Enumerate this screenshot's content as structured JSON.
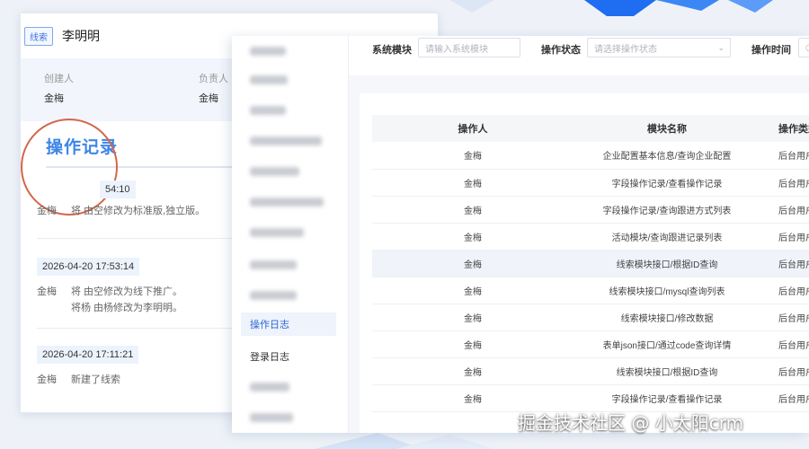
{
  "lead": {
    "tag": "线索",
    "name": "李明明",
    "info": [
      {
        "label": "创建人",
        "value": "金梅"
      },
      {
        "label": "负责人",
        "value": "金梅"
      }
    ]
  },
  "operation_record": {
    "title": "操作记录",
    "entries": [
      {
        "time": "54:10",
        "lines": [
          {
            "who": "金梅",
            "text": "将 由空修改为标准版,独立版。"
          }
        ]
      },
      {
        "time": "2026-04-20 17:53:14",
        "lines": [
          {
            "who": "金梅",
            "text": "将 由空修改为线下推广。"
          },
          {
            "who": "",
            "text": "将杨 由杨修改为李明明。"
          }
        ]
      },
      {
        "time": "2026-04-20 17:11:21",
        "lines": [
          {
            "who": "金梅",
            "text": "新建了线索"
          }
        ]
      }
    ]
  },
  "sidebar": {
    "active": "操作日志",
    "login_log": "登录日志"
  },
  "filters": {
    "module_label": "系统模块",
    "module_placeholder": "请输入系统模块",
    "status_label": "操作状态",
    "status_placeholder": "请选择操作状态",
    "time_label": "操作时间"
  },
  "table": {
    "headers": [
      "操作人",
      "模块名称",
      "操作类型"
    ],
    "rows": [
      [
        "金梅",
        "企业配置基本信息/查询企业配置",
        "后台用户"
      ],
      [
        "金梅",
        "字段操作记录/查看操作记录",
        "后台用户"
      ],
      [
        "金梅",
        "字段操作记录/查询跟进方式列表",
        "后台用户"
      ],
      [
        "金梅",
        "活动模块/查询跟进记录列表",
        "后台用户"
      ],
      [
        "金梅",
        "线索模块接口/根据ID查询",
        "后台用户"
      ],
      [
        "金梅",
        "线索模块接口/mysql查询列表",
        "后台用户"
      ],
      [
        "金梅",
        "线索模块接口/修改数据",
        "后台用户"
      ],
      [
        "金梅",
        "表单json接口/通过code查询详情",
        "后台用户"
      ],
      [
        "金梅",
        "线索模块接口/根据ID查询",
        "后台用户"
      ],
      [
        "金梅",
        "字段操作记录/查看操作记录",
        "后台用户"
      ]
    ]
  },
  "watermark": "掘金技术社区 @ 小太阳crm",
  "colors": {
    "accent": "#3d86e6",
    "circle": "#d4664a",
    "active_bg": "#eef3fc"
  }
}
